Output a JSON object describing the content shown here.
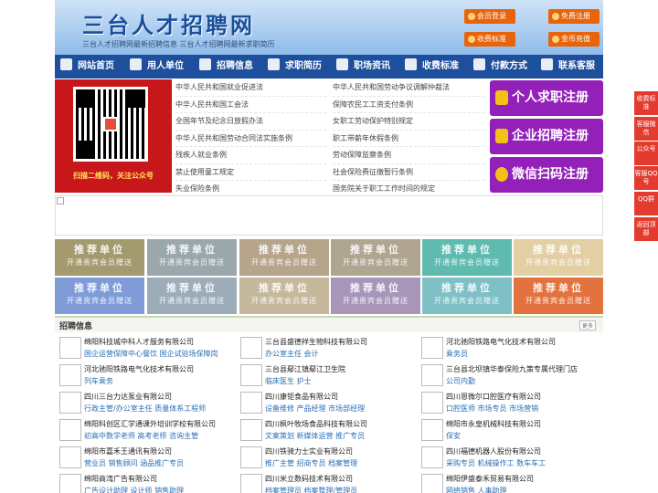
{
  "header": {
    "site_title": "三台人才招聘网",
    "subtitle": "三台人才招聘网最新招聘信息    三台人才招聘网最新求职简历",
    "buttons": [
      {
        "label": "会员登录",
        "icon": "user-icon"
      },
      {
        "label": "免费注册",
        "icon": "register-icon"
      },
      {
        "label": "收费标准",
        "icon": "price-icon"
      },
      {
        "label": "金币充值",
        "icon": "coin-icon"
      }
    ]
  },
  "nav": {
    "items": [
      {
        "label": "网站首页",
        "icon": "home-icon"
      },
      {
        "label": "用人单位",
        "icon": "building-icon"
      },
      {
        "label": "招聘信息",
        "icon": "recruit-icon"
      },
      {
        "label": "求职简历",
        "icon": "resume-icon"
      },
      {
        "label": "职场资讯",
        "icon": "news-icon"
      },
      {
        "label": "收费标准",
        "icon": "price-icon"
      },
      {
        "label": "付款方式",
        "icon": "payment-icon"
      },
      {
        "label": "联系客服",
        "icon": "phone-icon"
      }
    ]
  },
  "qr": {
    "caption": "扫描二维码，关注公众号"
  },
  "laws": {
    "left": [
      "中华人民共和国就业促进法",
      "中华人民共和国工会法",
      "全国年节及纪念日放假办法",
      "中华人民共和国劳动合同法实施条例",
      "残疾人就业条例",
      "禁止使用童工规定",
      "失业保险条例"
    ],
    "right": [
      "中华人民共和国劳动争议调解仲裁法",
      "保障农民工工资支付条例",
      "女职工劳动保护特别规定",
      "职工带薪年休假条例",
      "劳动保障监察条例",
      "社会保险费征缴暂行条例",
      "国务院关于职工工作时间的规定"
    ]
  },
  "register": [
    {
      "label": "个人求职注册",
      "icon": "person-icon"
    },
    {
      "label": "企业招聘注册",
      "icon": "enterprise-icon"
    },
    {
      "label": "微信扫码注册",
      "icon": "wechat-icon"
    }
  ],
  "sidebar": [
    "收费标准",
    "客服微信",
    "公众号",
    "客服QQ号",
    "QQ群",
    "返回顶部"
  ],
  "recommend": {
    "title": "推荐单位",
    "sub": "开通贵宾会员赠送",
    "colors": [
      "#a49a6f",
      "#9aa7ad",
      "#b6a58b",
      "#b0a590",
      "#5fbab0",
      "#e2d0a4",
      "#7f9cd8",
      "#9cadb9",
      "#c5b89c",
      "#a896ba",
      "#7ec0c6",
      "#e2733f"
    ]
  },
  "jobs": {
    "section_title": "招聘信息",
    "more_label": "更多",
    "items": [
      {
        "company": "绵阳科技城中科人才服务有限公司",
        "positions": "国企运营保障中心餐饮 国企试验场保障岗"
      },
      {
        "company": "三台县盛德祥生物科技有限公司",
        "positions": "办公室主任 会计"
      },
      {
        "company": "河北驰阳铁路电气化技术有限公司",
        "positions": "乘务员"
      },
      {
        "company": "河北驰阳铁路电气化技术有限公司",
        "positions": "列车乘务"
      },
      {
        "company": "三台县鄢江镇鄢江卫生院",
        "positions": "临床医生 护士"
      },
      {
        "company": "三台县北坝镇华泰保险九策专属代理门店",
        "positions": "公司内勤"
      },
      {
        "company": "四川三台力达泵业有限公司",
        "positions": "行政主管/办公室主任 质量体系工程师"
      },
      {
        "company": "四川康钜食品有限公司",
        "positions": "设备维修 产品经理 市场部经理"
      },
      {
        "company": "四川恩微尔口腔医疗有限公司",
        "positions": "口腔医师 市场专员 市场营销"
      },
      {
        "company": "绵阳科创区汇学通课外培训学校有限公司",
        "positions": "初高中数学老师 高考老师 咨询主管"
      },
      {
        "company": "四川枫叶牧场食品科技有限公司",
        "positions": "文案策划 新媒体运营 推广专员"
      },
      {
        "company": "绵阳市永皇机械科技有限公司",
        "positions": "保安"
      },
      {
        "company": "绵阳市嘉禾王通讯有限公司",
        "positions": "营业员 销售顾问 涵品推广专员"
      },
      {
        "company": "四川铁骑力士实业有限公司",
        "positions": "推广主管 招商专员 档案管理"
      },
      {
        "company": "四川福德机器人股份有限公司",
        "positions": "采购专员 机械操作工 数车车工"
      },
      {
        "company": "绵阳商湾广告有限公司",
        "positions": "广告设计助理 设计师 销售助理"
      },
      {
        "company": "四川米立数码技术有限公司",
        "positions": "档案管理员 档案整理/管理员"
      },
      {
        "company": "绵阳伊盛泰禾贸易有限公司",
        "positions": "网络销售 人事助理"
      }
    ]
  }
}
